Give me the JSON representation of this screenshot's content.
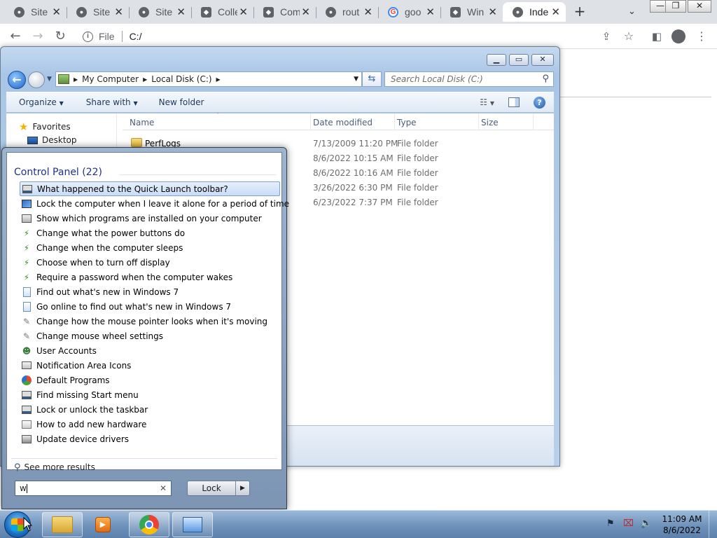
{
  "browser": {
    "tabs": [
      {
        "title": "Site",
        "icon": "globe-icon"
      },
      {
        "title": "Site",
        "icon": "globe-icon"
      },
      {
        "title": "Site",
        "icon": "globe-icon"
      },
      {
        "title": "Colle",
        "icon": "shield-icon"
      },
      {
        "title": "Com",
        "icon": "shield-icon"
      },
      {
        "title": "rout",
        "icon": "globe-icon"
      },
      {
        "title": "goo",
        "icon": "google-icon"
      },
      {
        "title": "Win",
        "icon": "shield-icon"
      },
      {
        "title": "Inde",
        "icon": "globe-icon"
      }
    ],
    "active_tab_index": 8,
    "address_scheme": "File",
    "address_url": "C:/"
  },
  "explorer": {
    "breadcrumb": [
      "My Computer",
      "Local Disk (C:)"
    ],
    "search_placeholder": "Search Local Disk (C:)",
    "commands": {
      "organize": "Organize",
      "share_with": "Share with",
      "new_folder": "New folder"
    },
    "nav": {
      "favorites": "Favorites",
      "desktop": "Desktop"
    },
    "columns": {
      "name": "Name",
      "date_modified": "Date modified",
      "type": "Type",
      "size": "Size"
    },
    "files": [
      {
        "name": "PerfLogs",
        "date": "7/13/2009 11:20 PM",
        "type": "File folder"
      },
      {
        "name": "",
        "date": "8/6/2022 10:15 AM",
        "type": "File folder"
      },
      {
        "name": "",
        "date": "8/6/2022 10:16 AM",
        "type": "File folder"
      },
      {
        "name": "",
        "date": "3/26/2022 6:30 PM",
        "type": "File folder"
      },
      {
        "name": "",
        "date": "6/23/2022 7:37 PM",
        "type": "File folder"
      }
    ]
  },
  "start_menu": {
    "section_title": "Control Panel (22)",
    "results": [
      {
        "label": "What happened to the Quick Launch toolbar?",
        "icon": "taskbar-icon",
        "selected": true
      },
      {
        "label": "Lock the computer when I leave it alone for a period of time",
        "icon": "monitor-icon"
      },
      {
        "label": "Show which programs are installed on your computer",
        "icon": "programs-icon"
      },
      {
        "label": "Change what the power buttons do",
        "icon": "power-options-icon"
      },
      {
        "label": "Change when the computer sleeps",
        "icon": "power-options-icon"
      },
      {
        "label": "Choose when to turn off display",
        "icon": "power-options-icon"
      },
      {
        "label": "Require a password when the computer wakes",
        "icon": "power-options-icon"
      },
      {
        "label": "Find out what's new in Windows 7",
        "icon": "document-icon"
      },
      {
        "label": "Go online to find out what's new in Windows 7",
        "icon": "document-icon"
      },
      {
        "label": "Change how the mouse pointer looks when it's moving",
        "icon": "mouse-icon"
      },
      {
        "label": "Change mouse wheel settings",
        "icon": "mouse-icon"
      },
      {
        "label": "User Accounts",
        "icon": "users-icon"
      },
      {
        "label": "Notification Area Icons",
        "icon": "notification-area-icon"
      },
      {
        "label": "Default Programs",
        "icon": "default-programs-icon"
      },
      {
        "label": "Find missing Start menu",
        "icon": "taskbar-icon"
      },
      {
        "label": "Lock or unlock the taskbar",
        "icon": "taskbar-icon"
      },
      {
        "label": "How to add new hardware",
        "icon": "hardware-icon"
      },
      {
        "label": "Update device drivers",
        "icon": "printer-icon"
      }
    ],
    "see_more": "See more results",
    "search_value": "w",
    "lock_button": "Lock"
  },
  "taskbar": {
    "pinned": [
      {
        "name": "file-explorer-icon"
      },
      {
        "name": "media-player-icon"
      },
      {
        "name": "chrome-icon"
      },
      {
        "name": "control-panel-icon"
      }
    ],
    "time": "11:09 AM",
    "date": "8/6/2022"
  }
}
